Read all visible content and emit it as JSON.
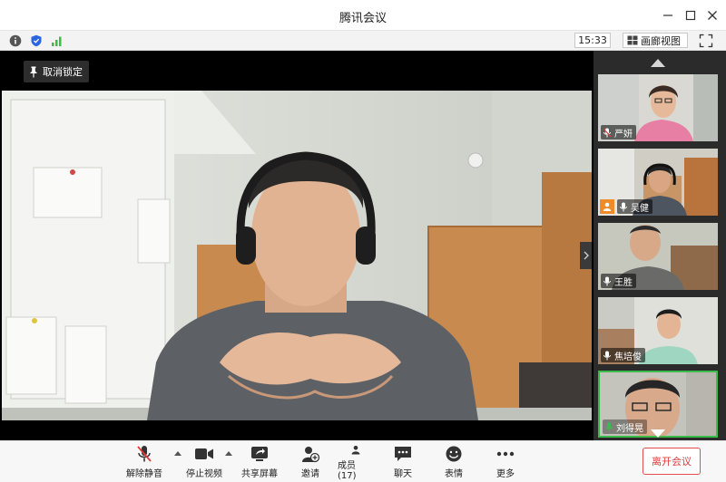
{
  "window": {
    "title": "腾讯会议"
  },
  "statusbar": {
    "time": "15:33",
    "view_label": "画廊视图"
  },
  "stage": {
    "unlock_label": "取消锁定"
  },
  "participants": [
    {
      "name": "严妍",
      "muted": true,
      "host": false,
      "active": false
    },
    {
      "name": "吴健",
      "muted": false,
      "host": true,
      "active": false
    },
    {
      "name": "王胜",
      "muted": false,
      "host": false,
      "active": false
    },
    {
      "name": "焦培俊",
      "muted": false,
      "host": false,
      "active": false
    },
    {
      "name": "刘得晃",
      "muted": false,
      "host": false,
      "active": true
    }
  ],
  "toolbar": {
    "unmute": "解除静音",
    "stop_video": "停止视频",
    "share": "共享屏幕",
    "invite": "邀请",
    "members": "成员(17)",
    "chat": "聊天",
    "reactions": "表情",
    "more": "更多",
    "leave": "离开会议"
  },
  "colors": {
    "accent": "#2b66e0",
    "leave": "#e03a3a",
    "active_speaker": "#3dbb4a",
    "host_badge": "#f08c28"
  }
}
